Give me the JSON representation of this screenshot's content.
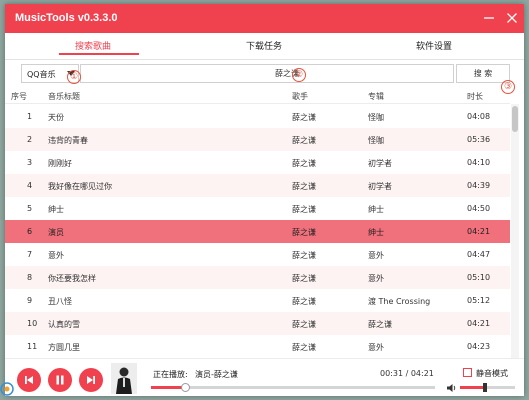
{
  "app": {
    "title": "MusicTools v0.3.3.0"
  },
  "tabs": [
    {
      "label": "搜索歌曲",
      "active": true
    },
    {
      "label": "下载任务",
      "active": false
    },
    {
      "label": "软件设置",
      "active": false
    }
  ],
  "search": {
    "source": "QQ音乐",
    "query": "薛之谦",
    "button_label": "搜 索"
  },
  "markers": [
    "①",
    "②",
    "③"
  ],
  "table": {
    "columns": [
      "序号",
      "音乐标题",
      "歌手",
      "专辑",
      "时长"
    ],
    "rows": [
      {
        "no": "1",
        "title": "天份",
        "artist": "薛之谦",
        "album": "怪咖",
        "duration": "04:08"
      },
      {
        "no": "2",
        "title": "违背的青春",
        "artist": "薛之谦",
        "album": "怪咖",
        "duration": "05:36"
      },
      {
        "no": "3",
        "title": "刚刚好",
        "artist": "薛之谦",
        "album": "初学者",
        "duration": "04:10"
      },
      {
        "no": "4",
        "title": "我好像在哪见过你",
        "artist": "薛之谦",
        "album": "初学者",
        "duration": "04:39"
      },
      {
        "no": "5",
        "title": "绅士",
        "artist": "薛之谦",
        "album": "绅士",
        "duration": "04:50"
      },
      {
        "no": "6",
        "title": "演员",
        "artist": "薛之谦",
        "album": "绅士",
        "duration": "04:21"
      },
      {
        "no": "7",
        "title": "意外",
        "artist": "薛之谦",
        "album": "意外",
        "duration": "04:47"
      },
      {
        "no": "8",
        "title": "你还要我怎样",
        "artist": "薛之谦",
        "album": "意外",
        "duration": "05:10"
      },
      {
        "no": "9",
        "title": "丑八怪",
        "artist": "薛之谦",
        "album": "渡 The Crossing",
        "duration": "05:12"
      },
      {
        "no": "10",
        "title": "认真的雪",
        "artist": "薛之谦",
        "album": "薛之谦",
        "duration": "04:21"
      },
      {
        "no": "11",
        "title": "方圆几里",
        "artist": "薛之谦",
        "album": "意外",
        "duration": "04:23"
      }
    ],
    "selected_index": 5
  },
  "player": {
    "now_playing_label": "正在播放:",
    "now_playing_track": "演员-薛之谦",
    "time": "00:31 / 04:21",
    "progress": 0.12,
    "mute_label": "静音模式",
    "mute_checked": false,
    "volume": 0.45
  },
  "colors": {
    "accent": "#f0414f",
    "selected_row": "#f0707b",
    "alt_row": "#fdf3f3",
    "marker": "#e8533f"
  },
  "icons": [
    "minimize-icon",
    "close-icon",
    "dropdown-caret-icon",
    "previous-icon",
    "pause-icon",
    "next-icon",
    "volume-icon"
  ]
}
